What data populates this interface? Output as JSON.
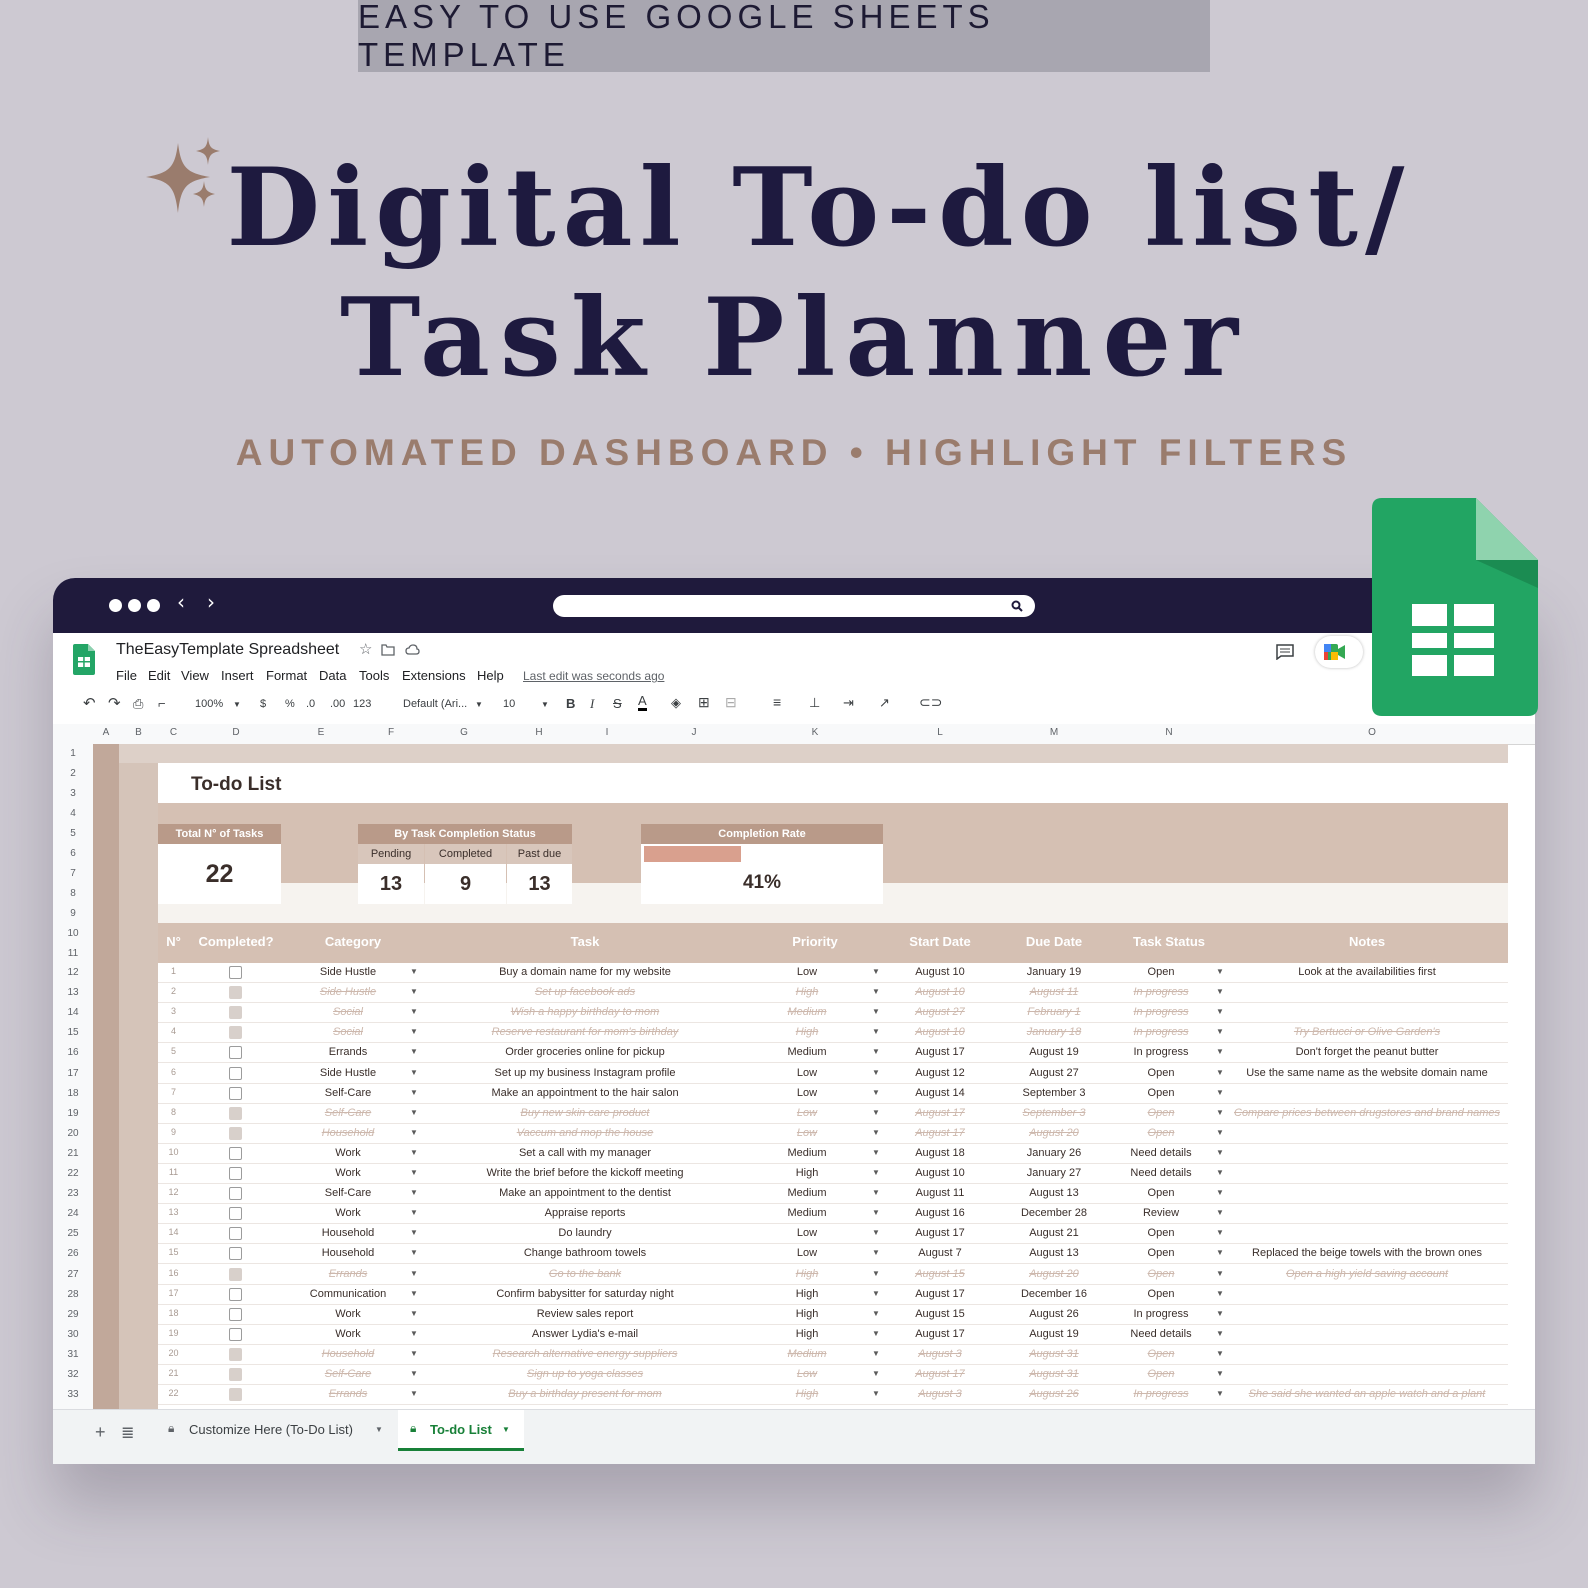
{
  "banner": "EASY TO USE GOOGLE SHEETS TEMPLATE",
  "title_line1": "Digital To-do list/",
  "title_line2": "Task Planner",
  "subtitle": "AUTOMATED DASHBOARD  •  HIGHLIGHT FILTERS",
  "sheets": {
    "doc_title": "TheEasyTemplate Spreadsheet",
    "menu": [
      "File",
      "Edit",
      "View",
      "Insert",
      "Format",
      "Data",
      "Tools",
      "Extensions",
      "Help"
    ],
    "last_edit": "Last edit was seconds ago",
    "toolbar": {
      "zoom": "100%",
      "currency": "$",
      "percent": "%",
      "dec_less": ".0",
      "dec_more": ".00",
      "format": "123",
      "font": "Default (Ari...",
      "size": "10"
    },
    "columns": [
      "A",
      "B",
      "C",
      "D",
      "E",
      "F",
      "G",
      "H",
      "I",
      "J",
      "K",
      "L",
      "M",
      "N",
      "O"
    ],
    "rows": [
      "1",
      "2",
      "3",
      "4",
      "5",
      "6",
      "7",
      "8",
      "9",
      "10",
      "11",
      "12",
      "13",
      "14",
      "15",
      "16",
      "17",
      "18",
      "19",
      "20",
      "21",
      "22",
      "23",
      "24",
      "25",
      "26",
      "27",
      "28",
      "29",
      "30",
      "31",
      "32",
      "33"
    ]
  },
  "dashboard": {
    "title": "To-do List",
    "total_label": "Total N° of Tasks",
    "total_value": "22",
    "status_label": "By Task Completion Status",
    "pending_label": "Pending",
    "pending_value": "13",
    "completed_label": "Completed",
    "completed_value": "9",
    "pastdue_label": "Past due",
    "pastdue_value": "13",
    "rate_label": "Completion Rate",
    "rate_value": "41%",
    "rate_fraction": 0.41,
    "accent": "#d9a08e"
  },
  "table": {
    "headers": [
      "N°",
      "Completed?",
      "Category",
      "Task",
      "Priority",
      "Start Date",
      "Due Date",
      "Task Status",
      "Notes"
    ],
    "rows": [
      {
        "n": "1",
        "done": false,
        "category": "Side Hustle",
        "task": "Buy a domain name for my website",
        "priority": "Low",
        "start": "August 10",
        "due": "January 19",
        "status": "Open",
        "notes": "Look at the availabilities first"
      },
      {
        "n": "2",
        "done": true,
        "category": "Side Hustle",
        "task": "Set up facebook ads",
        "priority": "High",
        "start": "August 10",
        "due": "August 11",
        "status": "In progress",
        "notes": ""
      },
      {
        "n": "3",
        "done": true,
        "category": "Social",
        "task": "Wish a happy birthday to mom",
        "priority": "Medium",
        "start": "August 27",
        "due": "February 1",
        "status": "In progress",
        "notes": ""
      },
      {
        "n": "4",
        "done": true,
        "category": "Social",
        "task": "Reserve restaurant for mom's birthday",
        "priority": "High",
        "start": "August 10",
        "due": "January 18",
        "status": "In progress",
        "notes": "Try Bertucci or Olive Garden's"
      },
      {
        "n": "5",
        "done": false,
        "category": "Errands",
        "task": "Order groceries online for pickup",
        "priority": "Medium",
        "start": "August 17",
        "due": "August 19",
        "status": "In progress",
        "notes": "Don't forget the peanut butter"
      },
      {
        "n": "6",
        "done": false,
        "category": "Side Hustle",
        "task": "Set up my business Instagram profile",
        "priority": "Low",
        "start": "August 12",
        "due": "August 27",
        "status": "Open",
        "notes": "Use the same name as the website domain name"
      },
      {
        "n": "7",
        "done": false,
        "category": "Self-Care",
        "task": "Make an appointment to the hair salon",
        "priority": "Low",
        "start": "August 14",
        "due": "September 3",
        "status": "Open",
        "notes": ""
      },
      {
        "n": "8",
        "done": true,
        "category": "Self-Care",
        "task": "Buy new skin care product",
        "priority": "Low",
        "start": "August 17",
        "due": "September 3",
        "status": "Open",
        "notes": "Compare prices between drugstores and brand names"
      },
      {
        "n": "9",
        "done": true,
        "category": "Household",
        "task": "Vaccum and mop the house",
        "priority": "Low",
        "start": "August 17",
        "due": "August 20",
        "status": "Open",
        "notes": ""
      },
      {
        "n": "10",
        "done": false,
        "category": "Work",
        "task": "Set a call with my manager",
        "priority": "Medium",
        "start": "August 18",
        "due": "January 26",
        "status": "Need details",
        "notes": ""
      },
      {
        "n": "11",
        "done": false,
        "category": "Work",
        "task": "Write the brief before the kickoff meeting",
        "priority": "High",
        "start": "August 10",
        "due": "January 27",
        "status": "Need details",
        "notes": ""
      },
      {
        "n": "12",
        "done": false,
        "category": "Self-Care",
        "task": "Make an appointment to the dentist",
        "priority": "Medium",
        "start": "August 11",
        "due": "August 13",
        "status": "Open",
        "notes": ""
      },
      {
        "n": "13",
        "done": false,
        "category": "Work",
        "task": "Appraise reports",
        "priority": "Medium",
        "start": "August 16",
        "due": "December 28",
        "status": "Review",
        "notes": ""
      },
      {
        "n": "14",
        "done": false,
        "category": "Household",
        "task": "Do laundry",
        "priority": "Low",
        "start": "August 17",
        "due": "August 21",
        "status": "Open",
        "notes": ""
      },
      {
        "n": "15",
        "done": false,
        "category": "Household",
        "task": "Change bathroom towels",
        "priority": "Low",
        "start": "August 7",
        "due": "August 13",
        "status": "Open",
        "notes": "Replaced the beige towels with the brown ones"
      },
      {
        "n": "16",
        "done": true,
        "category": "Errands",
        "task": "Go to the bank",
        "priority": "High",
        "start": "August 15",
        "due": "August 20",
        "status": "Open",
        "notes": "Open a high yield saving account"
      },
      {
        "n": "17",
        "done": false,
        "category": "Communication",
        "task": "Confirm babysitter for saturday night",
        "priority": "High",
        "start": "August 17",
        "due": "December 16",
        "status": "Open",
        "notes": ""
      },
      {
        "n": "18",
        "done": false,
        "category": "Work",
        "task": "Review sales report",
        "priority": "High",
        "start": "August 15",
        "due": "August 26",
        "status": "In progress",
        "notes": ""
      },
      {
        "n": "19",
        "done": false,
        "category": "Work",
        "task": "Answer Lydia's e-mail",
        "priority": "High",
        "start": "August 17",
        "due": "August 19",
        "status": "Need details",
        "notes": ""
      },
      {
        "n": "20",
        "done": true,
        "category": "Household",
        "task": "Research alternative energy suppliers",
        "priority": "Medium",
        "start": "August 3",
        "due": "August 31",
        "status": "Open",
        "notes": ""
      },
      {
        "n": "21",
        "done": true,
        "category": "Self-Care",
        "task": "Sign up to yoga classes",
        "priority": "Low",
        "start": "August 17",
        "due": "August 31",
        "status": "Open",
        "notes": ""
      },
      {
        "n": "22",
        "done": true,
        "category": "Errands",
        "task": "Buy a birthday present for mom",
        "priority": "High",
        "start": "August 3",
        "due": "August 26",
        "status": "In progress",
        "notes": "She said she wanted an apple watch and a plant"
      }
    ]
  },
  "tabs": {
    "tab1": "Customize Here (To-Do List)",
    "tab2": "To-do List"
  },
  "colors": {
    "brand_dark": "#1e1a3f",
    "accent_brown": "#9a7c6d",
    "sheets_green": "#23a566"
  }
}
